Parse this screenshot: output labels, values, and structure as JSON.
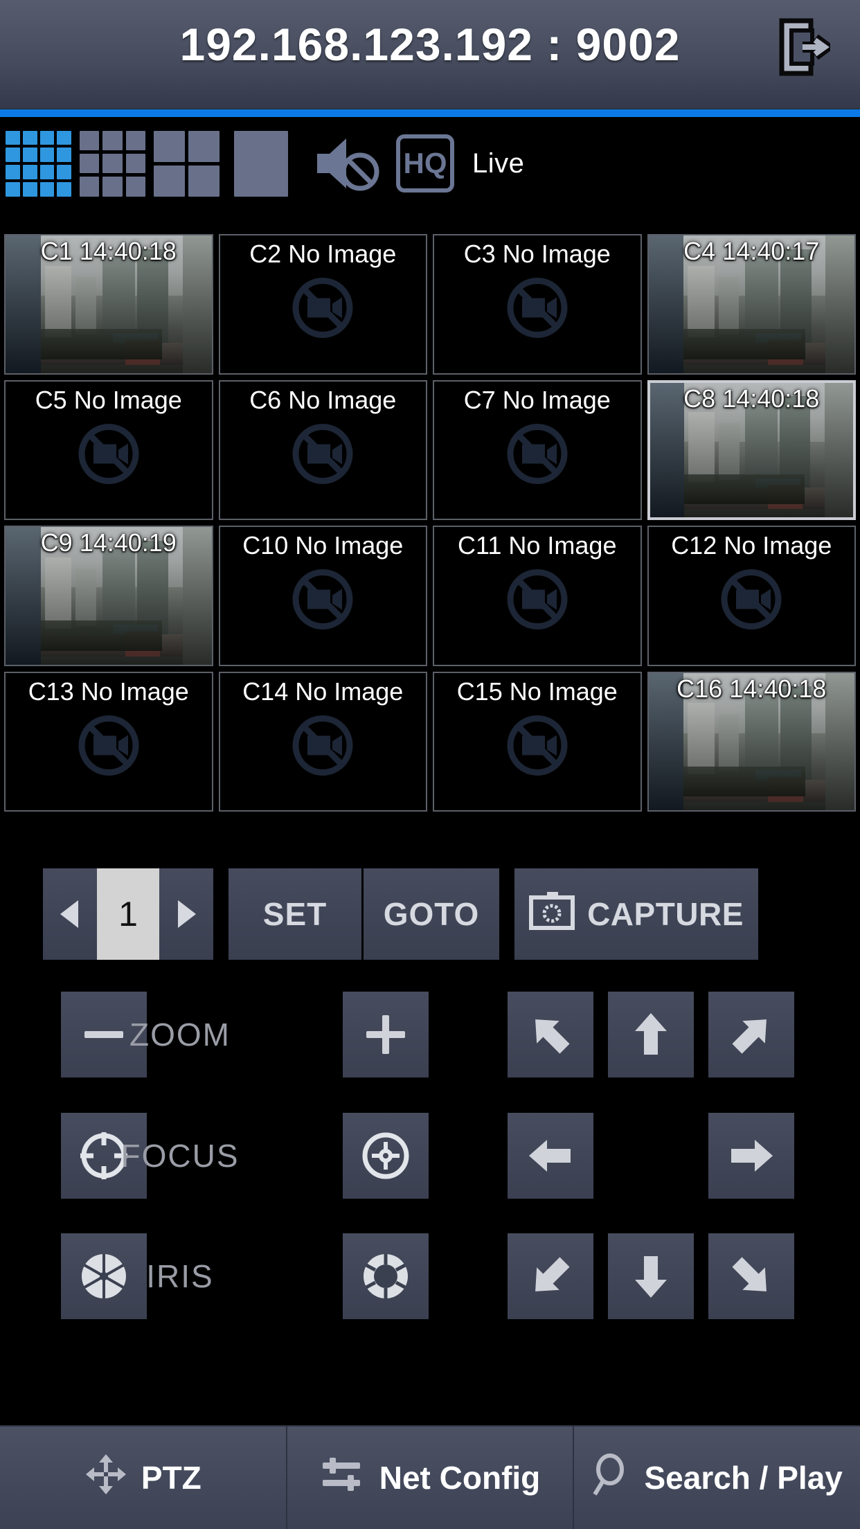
{
  "header": {
    "title": "192.168.123.192 : 9002",
    "logout_icon": "exit-icon"
  },
  "toolbar": {
    "layouts": [
      {
        "name": "grid-16-layout",
        "cells": 16,
        "active": true
      },
      {
        "name": "grid-9-layout",
        "cells": 9,
        "active": false
      },
      {
        "name": "grid-4-layout",
        "cells": 4,
        "active": false
      },
      {
        "name": "grid-1-layout",
        "cells": 1,
        "active": false
      }
    ],
    "mute_icon": "speaker-muted-icon",
    "quality_badge": "HQ",
    "mode_label": "Live"
  },
  "grid": {
    "cameras": [
      {
        "id": "C1",
        "label": "C1 14:40:18",
        "live": true,
        "selected": false
      },
      {
        "id": "C2",
        "label": "C2 No Image",
        "live": false,
        "selected": false
      },
      {
        "id": "C3",
        "label": "C3 No Image",
        "live": false,
        "selected": false
      },
      {
        "id": "C4",
        "label": "C4 14:40:17",
        "live": true,
        "selected": false
      },
      {
        "id": "C5",
        "label": "C5 No Image",
        "live": false,
        "selected": false
      },
      {
        "id": "C6",
        "label": "C6 No Image",
        "live": false,
        "selected": false
      },
      {
        "id": "C7",
        "label": "C7 No Image",
        "live": false,
        "selected": false
      },
      {
        "id": "C8",
        "label": "C8 14:40:18",
        "live": true,
        "selected": true
      },
      {
        "id": "C9",
        "label": "C9 14:40:19",
        "live": true,
        "selected": false
      },
      {
        "id": "C10",
        "label": "C10 No Image",
        "live": false,
        "selected": false
      },
      {
        "id": "C11",
        "label": "C11 No Image",
        "live": false,
        "selected": false
      },
      {
        "id": "C12",
        "label": "C12 No Image",
        "live": false,
        "selected": false
      },
      {
        "id": "C13",
        "label": "C13 No Image",
        "live": false,
        "selected": false
      },
      {
        "id": "C14",
        "label": "C14 No Image",
        "live": false,
        "selected": false
      },
      {
        "id": "C15",
        "label": "C15 No Image",
        "live": false,
        "selected": false
      },
      {
        "id": "C16",
        "label": "C16 14:40:18",
        "live": true,
        "selected": false
      }
    ]
  },
  "preset": {
    "prev_icon": "triangle-left-icon",
    "value": "1",
    "next_icon": "triangle-right-icon",
    "set_label": "SET",
    "goto_label": "GOTO",
    "capture_label": "CAPTURE",
    "capture_icon": "camera-icon"
  },
  "ptz": {
    "zoom_label": "ZOOM",
    "focus_label": "FOCUS",
    "iris_label": "IRIS",
    "zoom_out_icon": "minus-icon",
    "zoom_in_icon": "plus-icon",
    "focus_near_icon": "focus-near-icon",
    "focus_far_icon": "focus-far-icon",
    "iris_close_icon": "iris-closed-icon",
    "iris_open_icon": "iris-open-icon",
    "directions": [
      "arrow-up-left-icon",
      "arrow-up-icon",
      "arrow-up-right-icon",
      "arrow-left-icon",
      "arrow-right-icon",
      "arrow-down-left-icon",
      "arrow-down-icon",
      "arrow-down-right-icon"
    ]
  },
  "bottom_nav": {
    "items": [
      {
        "label": "PTZ",
        "icon": "move-icon"
      },
      {
        "label": "Net Config",
        "icon": "sliders-icon"
      },
      {
        "label": "Search / Play",
        "icon": "search-icon"
      }
    ]
  },
  "colors": {
    "accent_blue": "#0b7ae8",
    "layout_active": "#2f97e0",
    "panel": "#424859",
    "header_top": "#565c6e",
    "icon_slate": "#6b7694"
  }
}
